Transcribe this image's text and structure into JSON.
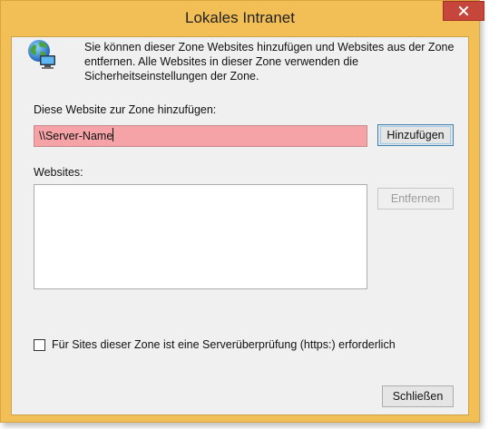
{
  "window": {
    "title": "Lokales Intranet",
    "accent_color": "#f2bf57",
    "close_button_color": "#c7463b",
    "close_icon": "close-icon"
  },
  "info": {
    "icon": "globe-computer-icon",
    "text": "Sie können dieser Zone Websites hinzufügen und Websites aus der Zone entfernen. Alle Websites in dieser Zone verwenden die Sicherheitseinstellungen der Zone."
  },
  "add_site": {
    "label": "Diese Website zur Zone hinzufügen:",
    "input_value": "\\\\Server-Name",
    "input_bg_color": "#f5a3a7",
    "button_label": "Hinzufügen"
  },
  "websites": {
    "label": "Websites:",
    "items": [],
    "remove_button_label": "Entfernen"
  },
  "https_check": {
    "checked": false,
    "label": "Für Sites dieser Zone ist eine Serverüberprüfung (https:) erforderlich"
  },
  "footer": {
    "close_button_label": "Schließen"
  }
}
